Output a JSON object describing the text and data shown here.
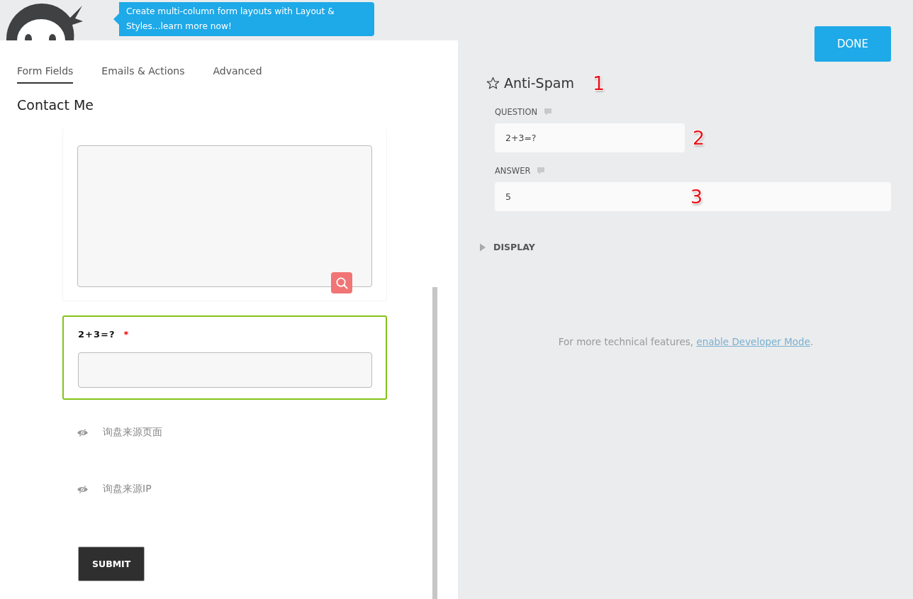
{
  "header": {
    "tooltip": "Create multi-column form layouts with Layout & Styles...learn more now!"
  },
  "tabs": [
    {
      "label": "Form Fields",
      "selected": true
    },
    {
      "label": "Emails & Actions",
      "selected": false
    },
    {
      "label": "Advanced",
      "selected": false
    }
  ],
  "form_title": "Contact Me",
  "preview": {
    "fields": [
      {
        "kind": "textarea",
        "selected": false
      },
      {
        "kind": "textbox",
        "label": "2+3=?",
        "required_mark": "*",
        "selected": true
      },
      {
        "kind": "hidden",
        "label": "询盘来源页面"
      },
      {
        "kind": "hidden",
        "label": "询盘来源IP"
      },
      {
        "kind": "submit",
        "label": "SUBMIT"
      }
    ]
  },
  "done_button": "DONE",
  "settings": {
    "title": "Anti-Spam",
    "title_annotation": "1",
    "fields": [
      {
        "kind": "short",
        "label": "QUESTION",
        "value": "2+3=?",
        "annotation": "2"
      },
      {
        "kind": "long",
        "label": "ANSWER",
        "value": "5",
        "annotation": "3"
      }
    ],
    "sections": [
      {
        "label": "DISPLAY",
        "expanded": false
      }
    ],
    "footer": {
      "text": "For more technical features, ",
      "link": "enable Developer Mode",
      "suffix": "."
    }
  }
}
